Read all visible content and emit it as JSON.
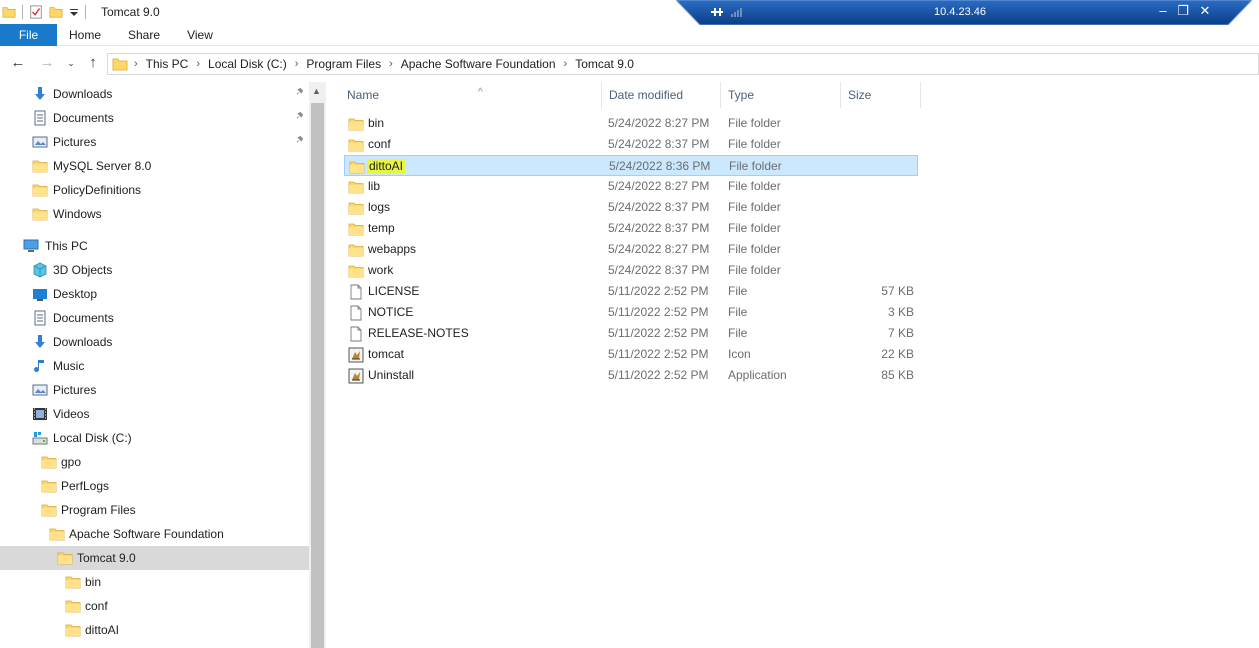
{
  "window": {
    "title": "Tomcat 9.0"
  },
  "remote": {
    "host": "10.4.23.46",
    "minimize": "–",
    "restore": "❐",
    "close": "✕"
  },
  "ribbon": {
    "tabs": [
      "File",
      "Home",
      "Share",
      "View"
    ]
  },
  "address": {
    "path": [
      "This PC",
      "Local Disk (C:)",
      "Program Files",
      "Apache Software Foundation",
      "Tomcat 9.0"
    ]
  },
  "nav": {
    "quick_access": [
      {
        "label": "Downloads",
        "icon": "downloads-icon",
        "pinned": true
      },
      {
        "label": "Documents",
        "icon": "documents-icon",
        "pinned": true
      },
      {
        "label": "Pictures",
        "icon": "pictures-icon",
        "pinned": true
      },
      {
        "label": "MySQL Server 8.0",
        "icon": "folder-icon",
        "pinned": false
      },
      {
        "label": "PolicyDefinitions",
        "icon": "folder-icon",
        "pinned": false
      },
      {
        "label": "Windows",
        "icon": "folder-icon",
        "pinned": false
      }
    ],
    "this_pc": "This PC",
    "pc_items": [
      {
        "label": "3D Objects",
        "icon": "3d-objects-icon"
      },
      {
        "label": "Desktop",
        "icon": "desktop-icon"
      },
      {
        "label": "Documents",
        "icon": "documents-icon"
      },
      {
        "label": "Downloads",
        "icon": "downloads-icon"
      },
      {
        "label": "Music",
        "icon": "music-icon"
      },
      {
        "label": "Pictures",
        "icon": "pictures-icon"
      },
      {
        "label": "Videos",
        "icon": "videos-icon"
      },
      {
        "label": "Local Disk (C:)",
        "icon": "drive-icon"
      }
    ],
    "tree": [
      {
        "label": "gpo",
        "level": 1
      },
      {
        "label": "PerfLogs",
        "level": 1
      },
      {
        "label": "Program Files",
        "level": 1
      },
      {
        "label": "Apache Software Foundation",
        "level": 2
      },
      {
        "label": "Tomcat 9.0",
        "level": 3,
        "selected": true
      },
      {
        "label": "bin",
        "level": 4
      },
      {
        "label": "conf",
        "level": 4
      },
      {
        "label": "dittoAI",
        "level": 4
      }
    ]
  },
  "columns": {
    "name": "Name",
    "date": "Date modified",
    "type": "Type",
    "size": "Size",
    "sort_caret": "^"
  },
  "files": [
    {
      "name": "bin",
      "date": "5/24/2022 8:27 PM",
      "type": "File folder",
      "size": "",
      "icon": "folder-icon"
    },
    {
      "name": "conf",
      "date": "5/24/2022 8:37 PM",
      "type": "File folder",
      "size": "",
      "icon": "folder-icon"
    },
    {
      "name": "dittoAI",
      "date": "5/24/2022 8:36 PM",
      "type": "File folder",
      "size": "",
      "icon": "folder-icon",
      "selected": true,
      "highlight": "#e9f542"
    },
    {
      "name": "lib",
      "date": "5/24/2022 8:27 PM",
      "type": "File folder",
      "size": "",
      "icon": "folder-icon"
    },
    {
      "name": "logs",
      "date": "5/24/2022 8:37 PM",
      "type": "File folder",
      "size": "",
      "icon": "folder-icon"
    },
    {
      "name": "temp",
      "date": "5/24/2022 8:37 PM",
      "type": "File folder",
      "size": "",
      "icon": "folder-icon"
    },
    {
      "name": "webapps",
      "date": "5/24/2022 8:27 PM",
      "type": "File folder",
      "size": "",
      "icon": "folder-icon"
    },
    {
      "name": "work",
      "date": "5/24/2022 8:37 PM",
      "type": "File folder",
      "size": "",
      "icon": "folder-icon"
    },
    {
      "name": "LICENSE",
      "date": "5/11/2022 2:52 PM",
      "type": "File",
      "size": "57 KB",
      "icon": "file-icon"
    },
    {
      "name": "NOTICE",
      "date": "5/11/2022 2:52 PM",
      "type": "File",
      "size": "3 KB",
      "icon": "file-icon"
    },
    {
      "name": "RELEASE-NOTES",
      "date": "5/11/2022 2:52 PM",
      "type": "File",
      "size": "7 KB",
      "icon": "file-icon"
    },
    {
      "name": "tomcat",
      "date": "5/11/2022 2:52 PM",
      "type": "Icon",
      "size": "22 KB",
      "icon": "tomcat-app-icon"
    },
    {
      "name": "Uninstall",
      "date": "5/11/2022 2:52 PM",
      "type": "Application",
      "size": "85 KB",
      "icon": "tomcat-app-icon"
    }
  ],
  "colors": {
    "accent": "#1979ca",
    "selection": "#cce8ff",
    "selection_border": "#99d1ff",
    "folder": "#ffd767",
    "remote_bar": "#0a4a9c"
  }
}
